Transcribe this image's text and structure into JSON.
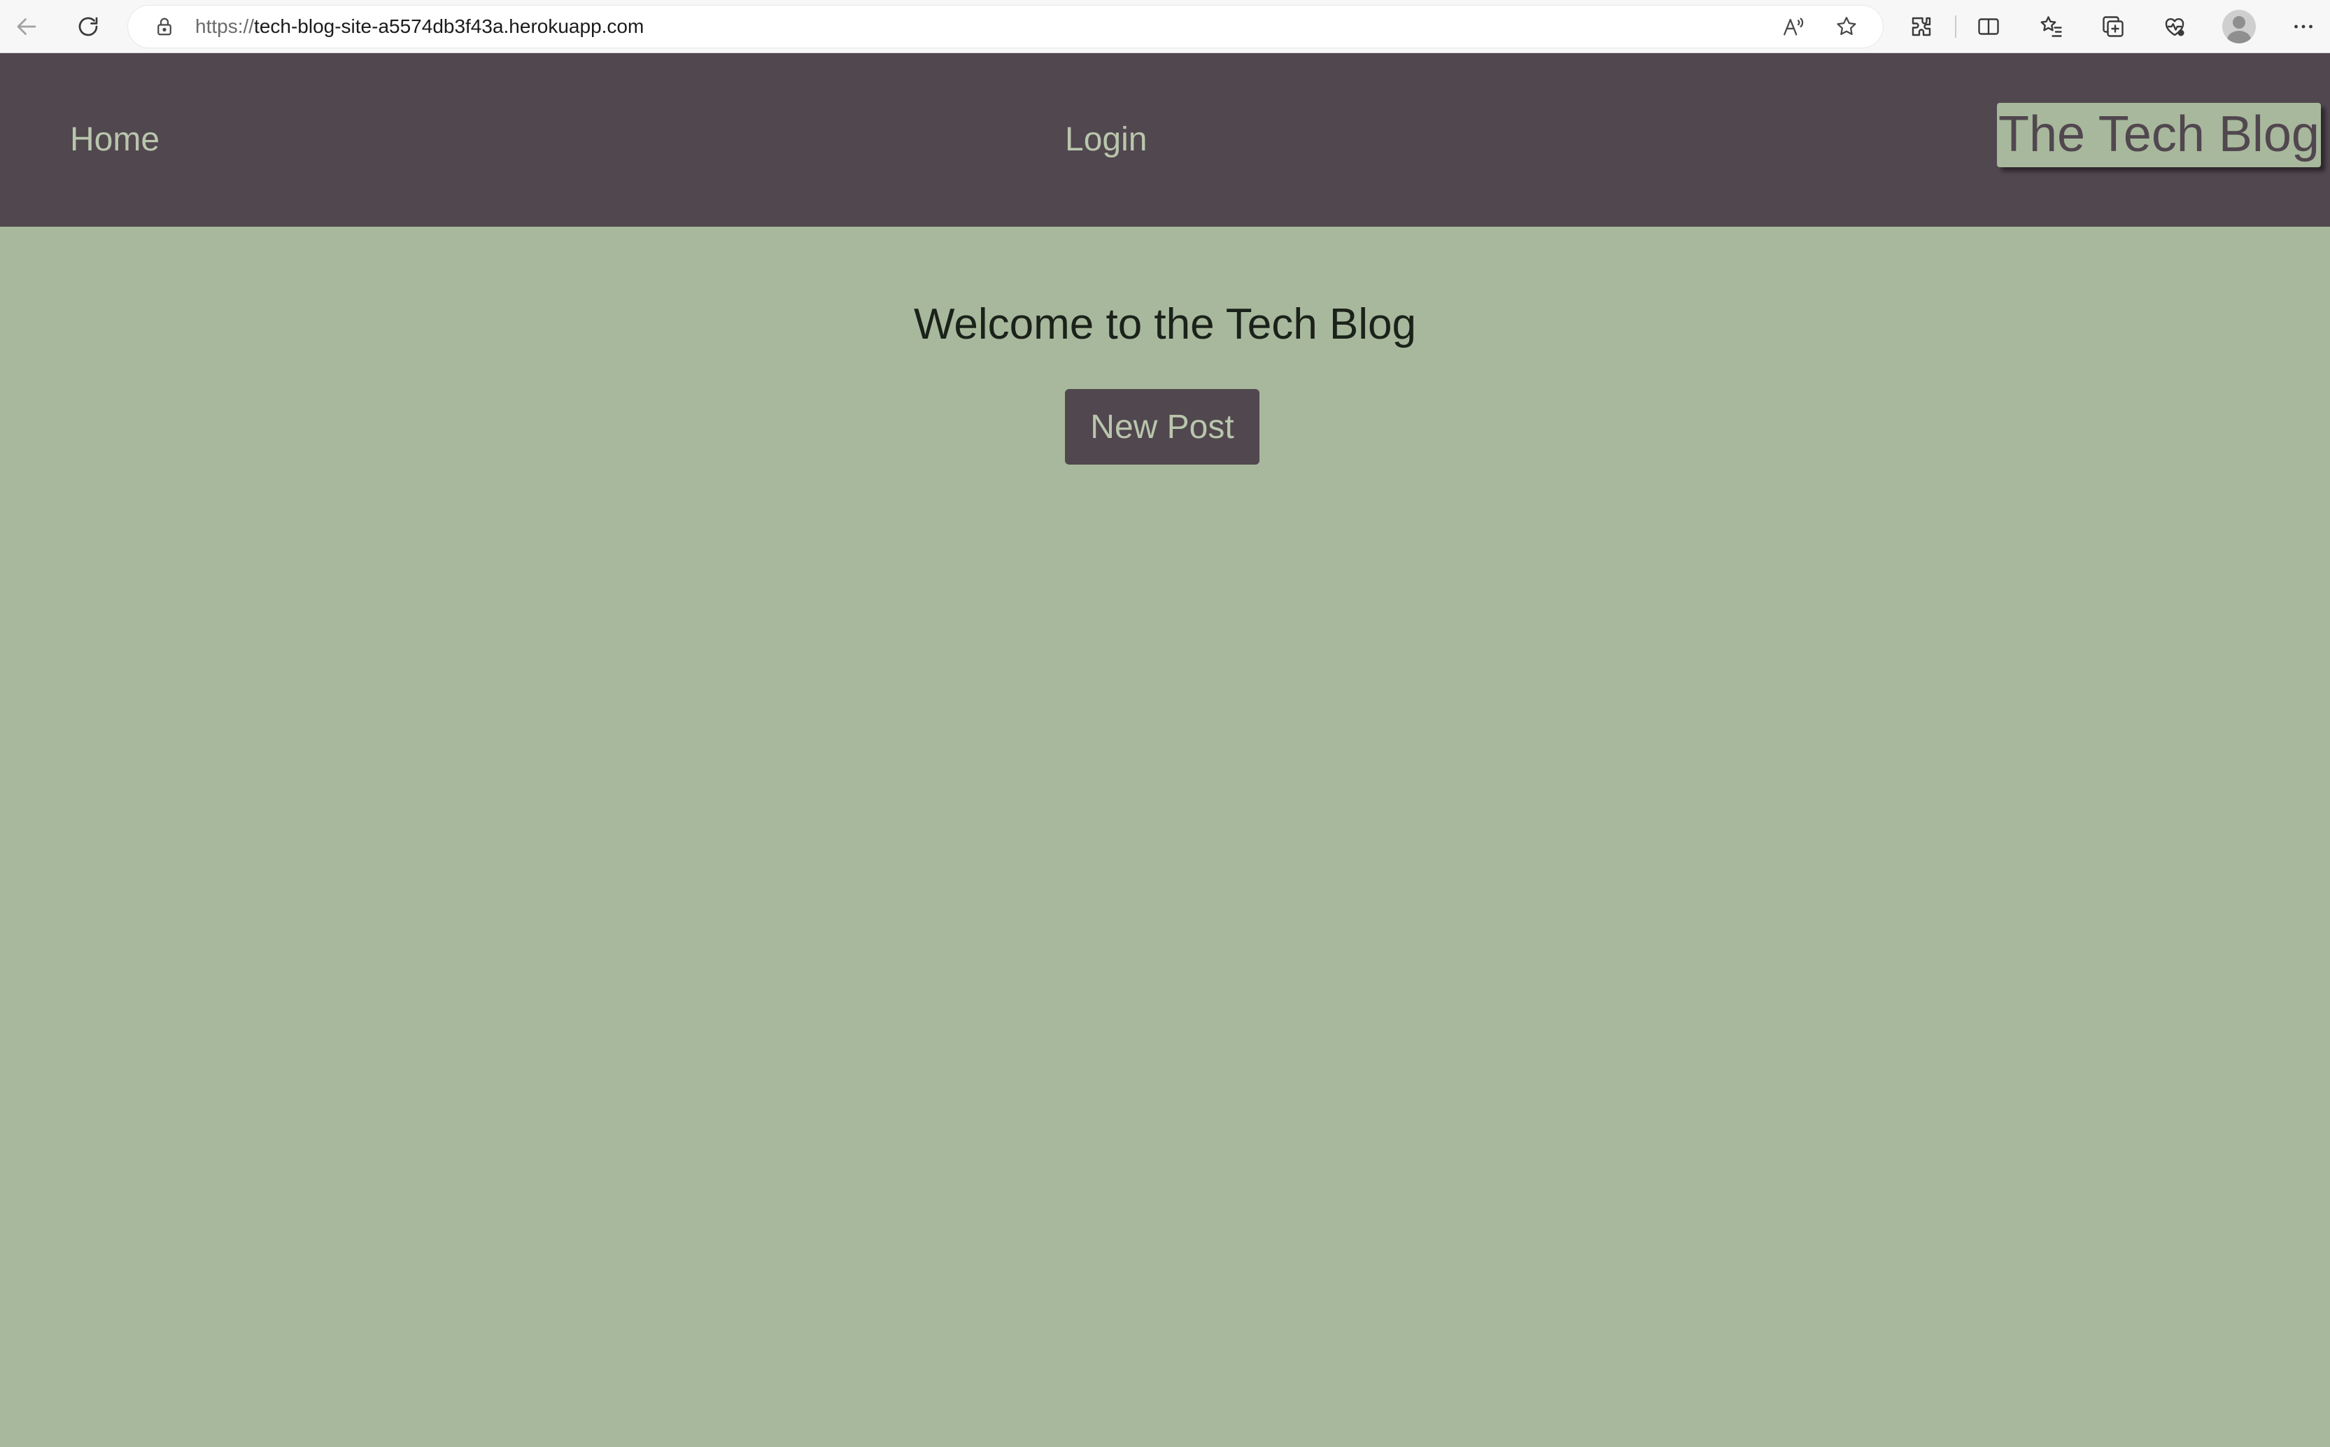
{
  "browser": {
    "url_scheme": "https://",
    "url_host": "tech-blog-site-a5574db3f43a.herokuapp.com",
    "icons": [
      "back-icon",
      "reload-icon",
      "lock-icon",
      "read-aloud-icon",
      "favorite-star-icon",
      "extensions-icon",
      "split-screen-icon",
      "favorites-icon",
      "collections-icon",
      "browser-essentials-icon",
      "profile-avatar",
      "more-icon"
    ]
  },
  "nav": {
    "home": "Home",
    "login": "Login",
    "brand": "The Tech Blog"
  },
  "main": {
    "title": "Welcome to the Tech Blog",
    "new_post_label": "New Post"
  },
  "colors": {
    "header_bg": "#51474f",
    "page_bg": "#a8b89c",
    "nav_text": "#b9c6ac",
    "title_text": "#1b221a"
  }
}
